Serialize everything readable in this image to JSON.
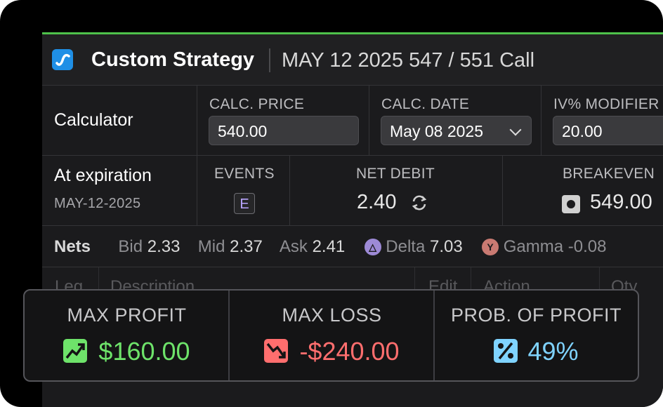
{
  "header": {
    "title": "Custom Strategy",
    "subtitle": "MAY 12 2025 547 / 551 Call",
    "logo_icon": "strategy-logo-icon"
  },
  "calculator": {
    "label": "Calculator",
    "calc_price_label": "CALC. PRICE",
    "calc_price_value": "540.00",
    "calc_date_label": "CALC. DATE",
    "calc_date_value": "May 08 2025",
    "iv_modifier_label": "IV% MODIFIER",
    "iv_modifier_value": "20.00"
  },
  "expiration": {
    "label": "At expiration",
    "date": "MAY-12-2025",
    "events_label": "EVENTS",
    "events_badge": "E",
    "net_debit_label": "NET DEBIT",
    "net_debit_value": "2.40",
    "breakeven_label": "BREAKEVEN",
    "breakeven_value": "549.00"
  },
  "nets": {
    "label": "Nets",
    "bid_label": "Bid",
    "bid_value": "2.33",
    "mid_label": "Mid",
    "mid_value": "2.37",
    "ask_label": "Ask",
    "ask_value": "2.41",
    "delta_label": "Delta",
    "delta_value": "7.03",
    "gamma_label": "Gamma",
    "gamma_value": "-0.08"
  },
  "table": {
    "columns": [
      "Leg",
      "Description",
      "Edit",
      "Action",
      "Qty"
    ]
  },
  "summary": {
    "max_profit_label": "MAX PROFIT",
    "max_profit_value": "$160.00",
    "max_loss_label": "MAX LOSS",
    "max_loss_value": "-$240.00",
    "prob_profit_label": "PROB. OF PROFIT",
    "prob_profit_value": "49%"
  },
  "colors": {
    "accent_green": "#4ec24b",
    "profit_green": "#6ee36a",
    "loss_red": "#ff6e6e",
    "prob_blue": "#7fd3ff",
    "logo_blue": "#1f8fe6",
    "delta_purple": "#9d8ad6",
    "gamma_red": "#c97a72"
  }
}
